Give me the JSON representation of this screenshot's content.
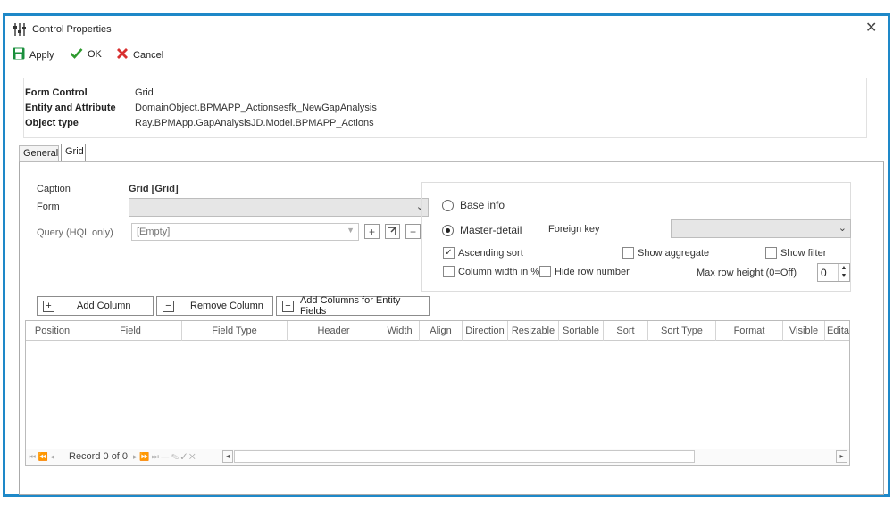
{
  "window": {
    "title": "Control Properties",
    "close_glyph": "✕"
  },
  "toolbar": {
    "apply_label": "Apply",
    "ok_label": "OK",
    "cancel_label": "Cancel"
  },
  "info": {
    "form_control_label": "Form Control",
    "form_control_value": "Grid",
    "entity_label": "Entity and Attribute",
    "entity_value": "DomainObject.BPMAPP_Actionsesfk_NewGapAnalysis",
    "object_type_label": "Object type",
    "object_type_value": "Ray.BPMApp.GapAnalysisJD.Model.BPMAPP_Actions"
  },
  "tabs": [
    {
      "label": "General",
      "active": false
    },
    {
      "label": "Grid",
      "active": true
    }
  ],
  "grid_tab": {
    "caption_label": "Caption",
    "caption_value": "Grid [Grid]",
    "form_label": "Form",
    "form_value": "",
    "query_label": "Query (HQL only)",
    "query_value": "[Empty]"
  },
  "options": {
    "base_info_label": "Base info",
    "base_info_selected": false,
    "master_detail_label": "Master-detail",
    "master_detail_selected": true,
    "foreign_key_label": "Foreign key",
    "foreign_key_value": "",
    "ascending_sort_label": "Ascending sort",
    "ascending_sort_checked": true,
    "show_aggregate_label": "Show aggregate",
    "show_aggregate_checked": false,
    "show_filter_label": "Show filter",
    "show_filter_checked": false,
    "column_width_label": "Column width in %",
    "column_width_checked": false,
    "hide_row_number_label": "Hide row number",
    "hide_row_number_checked": false,
    "max_row_height_label": "Max row height (0=Off)",
    "max_row_height_value": "0"
  },
  "grid_buttons": {
    "add_column": "Add Column",
    "remove_column": "Remove Column",
    "add_entity_fields": "Add Columns for Entity Fields"
  },
  "columns": [
    "Position",
    "Field",
    "Field Type",
    "Header",
    "Width",
    "Align",
    "Direction",
    "Resizable",
    "Sortable",
    "Sort",
    "Sort Type",
    "Format",
    "Visible",
    "Edita"
  ],
  "footer": {
    "record_text": "Record 0 of 0"
  },
  "colors": {
    "frame_border": "#1e88c8",
    "apply_green": "#1a8f3c",
    "ok_green": "#2e9a2e",
    "cancel_red": "#d83030"
  }
}
